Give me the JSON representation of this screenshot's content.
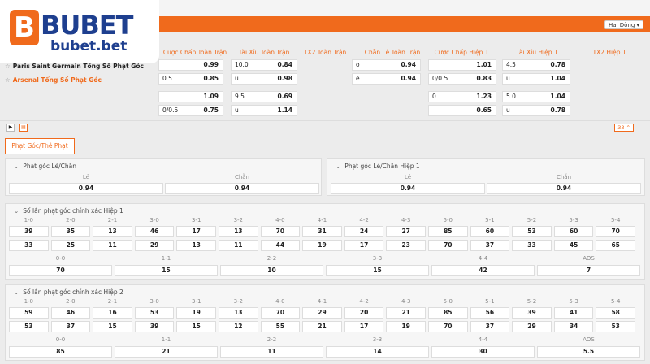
{
  "brand": {
    "badge": "B",
    "name": "BUBET",
    "domain": "bubet.bet"
  },
  "header": {
    "dropdown": "Hai Dòng ▾"
  },
  "market_headers": [
    "Cược Chấp Toàn Trận",
    "Tài Xỉu Toàn Trận",
    "1X2 Toàn Trận",
    "Chẵn Lẻ Toàn Trận",
    "Cược Chấp Hiệp 1",
    "Tài Xỉu Hiệp 1",
    "1X2 Hiệp 1"
  ],
  "matches": [
    {
      "team": "Paris Saint Germain Tổng Số Phạt Góc"
    },
    {
      "team": "Arsenal Tổng Số Phạt Góc"
    }
  ],
  "odds_rows": [
    {
      "hc_line": "",
      "hc_odds": "0.99",
      "ou_line": "10.0",
      "ou_odds": "0.84",
      "oe_line": "o",
      "oe_odds": "0.94",
      "h1hc_line": "",
      "h1hc_odds": "1.01",
      "h1ou_line": "4.5",
      "h1ou_odds": "0.78"
    },
    {
      "hc_line": "0.5",
      "hc_odds": "0.85",
      "ou_line": "u",
      "ou_odds": "0.98",
      "oe_line": "e",
      "oe_odds": "0.94",
      "h1hc_line": "0/0.5",
      "h1hc_odds": "0.83",
      "h1ou_line": "u",
      "h1ou_odds": "1.04"
    },
    {
      "hc_line": "",
      "hc_odds": "1.09",
      "ou_line": "9.5",
      "ou_odds": "0.69",
      "h1hc_line": "0",
      "h1hc_odds": "1.23",
      "h1ou_line": "5.0",
      "h1ou_odds": "1.04"
    },
    {
      "hc_line": "0/0.5",
      "hc_odds": "0.75",
      "ou_line": "u",
      "ou_odds": "1.14",
      "h1hc_line": "",
      "h1hc_odds": "0.65",
      "h1ou_line": "u",
      "h1ou_odds": "0.78"
    }
  ],
  "toolbar": {
    "play": "▶",
    "stats": "▤",
    "count": "33 ⌃"
  },
  "tab": "Phạt Góc/Thẻ Phạt",
  "oddeven_ft": {
    "title": "Phạt góc Lẻ/Chẵn",
    "labels": [
      "Lẻ",
      "Chẵn"
    ],
    "values": [
      "0.94",
      "0.94"
    ]
  },
  "oddeven_h1": {
    "title": "Phạt góc Lẻ/Chẵn Hiệp 1",
    "labels": [
      "Lẻ",
      "Chẵn"
    ],
    "values": [
      "0.94",
      "0.94"
    ]
  },
  "cs_labels": [
    "1-0",
    "2-0",
    "2-1",
    "3-0",
    "3-1",
    "3-2",
    "4-0",
    "4-1",
    "4-2",
    "4-3",
    "5-0",
    "5-1",
    "5-2",
    "5-3",
    "5-4"
  ],
  "draw_labels": [
    "0-0",
    "1-1",
    "2-2",
    "3-3",
    "4-4",
    "AOS"
  ],
  "cs_h1": {
    "title": "Số lần phạt góc chính xác Hiệp 1",
    "row1": [
      "39",
      "35",
      "13",
      "46",
      "17",
      "13",
      "70",
      "31",
      "24",
      "27",
      "85",
      "60",
      "53",
      "60",
      "70"
    ],
    "row2": [
      "33",
      "25",
      "11",
      "29",
      "13",
      "11",
      "44",
      "19",
      "17",
      "23",
      "70",
      "37",
      "33",
      "45",
      "65"
    ],
    "draws": [
      "70",
      "15",
      "10",
      "15",
      "42",
      "7"
    ]
  },
  "cs_h2": {
    "title": "Số lần phạt góc chính xác Hiệp 2",
    "row1": [
      "59",
      "46",
      "16",
      "53",
      "19",
      "13",
      "70",
      "29",
      "20",
      "21",
      "85",
      "56",
      "39",
      "41",
      "58"
    ],
    "row2": [
      "53",
      "37",
      "15",
      "39",
      "15",
      "12",
      "55",
      "21",
      "17",
      "19",
      "70",
      "37",
      "29",
      "34",
      "53"
    ],
    "draws": [
      "85",
      "21",
      "11",
      "14",
      "30",
      "5.5"
    ]
  }
}
